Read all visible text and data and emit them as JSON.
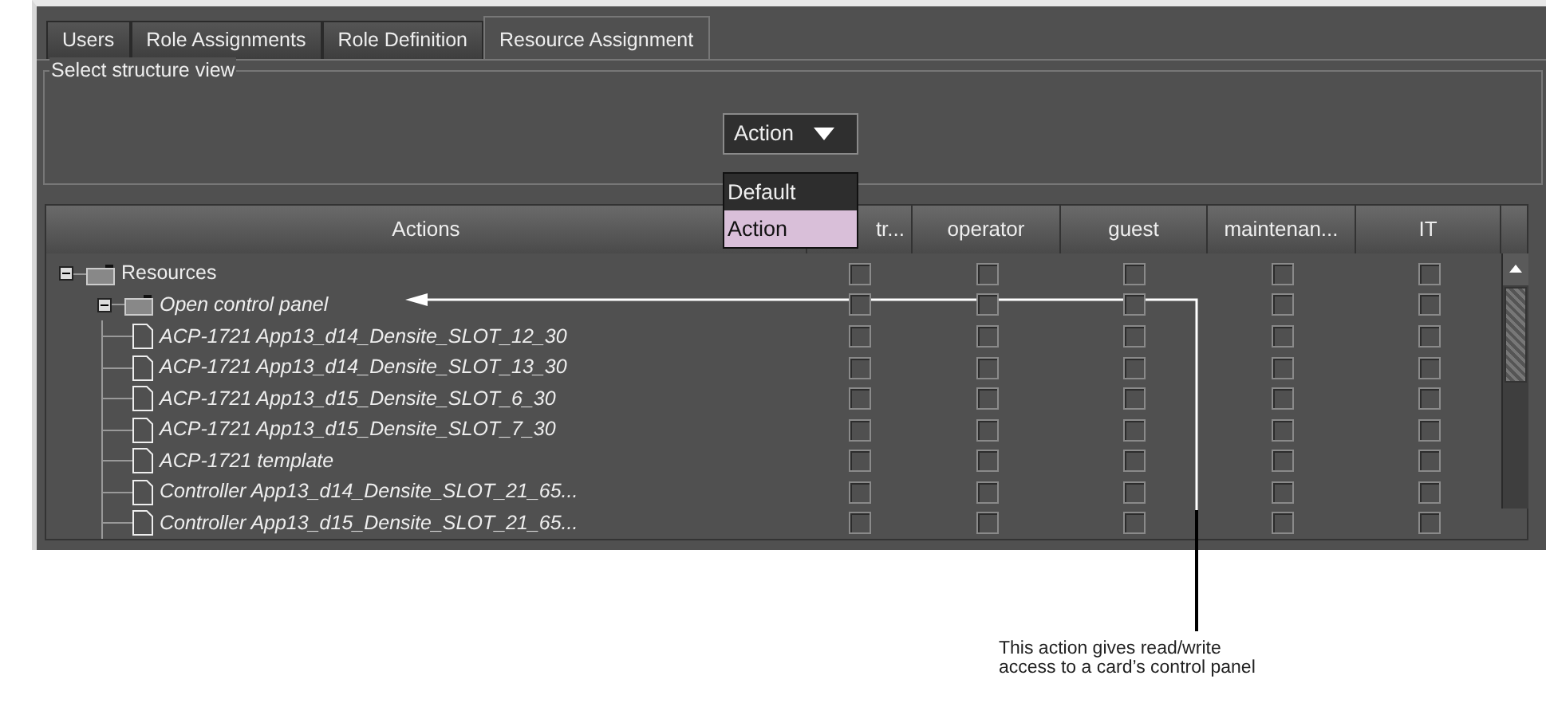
{
  "tabs": [
    {
      "label": "Users",
      "selected": false
    },
    {
      "label": "Role Assignments",
      "selected": false
    },
    {
      "label": "Role Definition",
      "selected": false
    },
    {
      "label": "Resource Assignment",
      "selected": true
    }
  ],
  "structure_view": {
    "legend": "Select structure view",
    "dropdown": {
      "value": "Action",
      "expanded": true,
      "options": [
        {
          "label": "Default",
          "selected": false
        },
        {
          "label": "Action",
          "selected": true
        }
      ]
    }
  },
  "table": {
    "columns": [
      "Actions",
      "tr...",
      "operator",
      "guest",
      "maintenan...",
      "IT"
    ],
    "rows": [
      {
        "label": "Resources",
        "kind": "folder",
        "expanded": true,
        "italic": false,
        "checks": [
          false,
          false,
          false,
          false,
          false
        ],
        "children": [
          {
            "label": "Open control panel",
            "kind": "folder",
            "expanded": true,
            "italic": true,
            "checks": [
              false,
              false,
              false,
              false,
              false
            ],
            "children": [
              {
                "label": "ACP-1721 App13_d14_Densite_SLOT_12_30",
                "kind": "file",
                "italic": true,
                "checks": [
                  false,
                  false,
                  false,
                  false,
                  false
                ]
              },
              {
                "label": "ACP-1721 App13_d14_Densite_SLOT_13_30",
                "kind": "file",
                "italic": true,
                "checks": [
                  false,
                  false,
                  false,
                  false,
                  false
                ]
              },
              {
                "label": "ACP-1721 App13_d15_Densite_SLOT_6_30",
                "kind": "file",
                "italic": true,
                "checks": [
                  false,
                  false,
                  false,
                  false,
                  false
                ]
              },
              {
                "label": "ACP-1721 App13_d15_Densite_SLOT_7_30",
                "kind": "file",
                "italic": true,
                "checks": [
                  false,
                  false,
                  false,
                  false,
                  false
                ]
              },
              {
                "label": "ACP-1721 template",
                "kind": "file",
                "italic": true,
                "checks": [
                  false,
                  false,
                  false,
                  false,
                  false
                ]
              },
              {
                "label": "Controller App13_d14_Densite_SLOT_21_65...",
                "kind": "file",
                "italic": true,
                "checks": [
                  false,
                  false,
                  false,
                  false,
                  false
                ]
              },
              {
                "label": "Controller App13_d15_Densite_SLOT_21_65...",
                "kind": "file",
                "italic": true,
                "checks": [
                  false,
                  false,
                  false,
                  false,
                  false
                ]
              }
            ]
          }
        ]
      }
    ]
  },
  "callout": {
    "text": "This action gives read/write access to a card’s control panel"
  }
}
